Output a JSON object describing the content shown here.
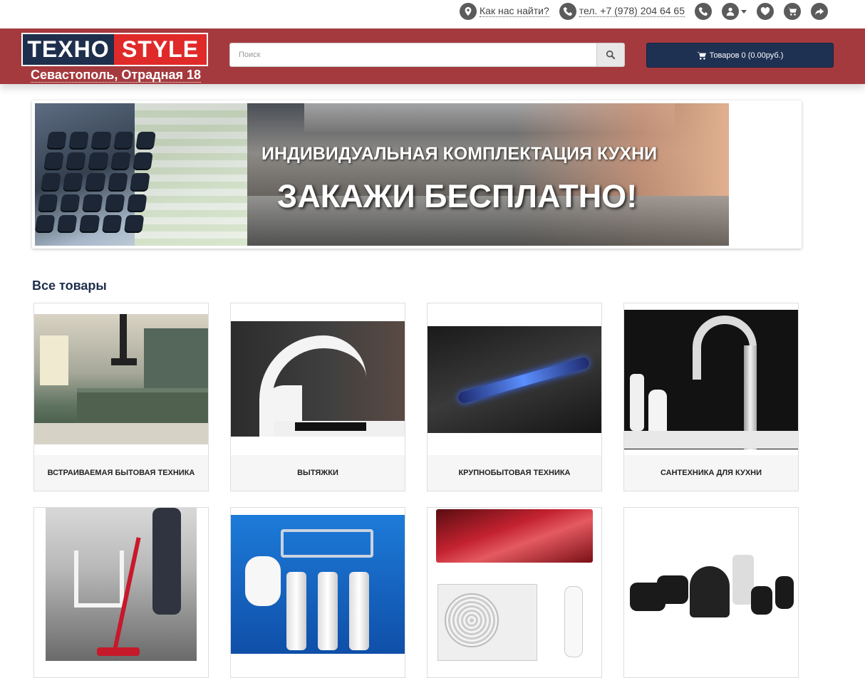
{
  "topbar": {
    "find_us": "Как нас найти?",
    "phone": "тел. +7 (978) 204 64 65",
    "icons": [
      "map-marker-icon",
      "phone-icon",
      "phone-icon",
      "user-icon",
      "heart-icon",
      "shopping-cart-icon",
      "share-icon"
    ]
  },
  "header": {
    "logo_part1": "TEXHO",
    "logo_part2": "STYLE",
    "address": "Севастополь, Отрадная 18",
    "search_placeholder": "Поиск",
    "cart_label": "Товаров 0 (0.00руб.)",
    "colors": {
      "header_bg": "#a53a3e",
      "logo_dark": "#1e2f4d",
      "logo_red": "#e02a2a",
      "cart_bg": "#1f3152"
    }
  },
  "banner": {
    "line1": "ИНДИВИДУАЛЬНАЯ КОМПЛЕКТАЦИЯ КУХНИ",
    "line2": "ЗАКАЖИ БЕСПЛАТНО!"
  },
  "section": {
    "title": "Все товары",
    "categories": [
      {
        "label": "Встраиваемая бытовая техника"
      },
      {
        "label": "Вытяжки"
      },
      {
        "label": "Крупнобытовая техника"
      },
      {
        "label": "Сантехника для кухни"
      },
      {
        "label": ""
      },
      {
        "label": ""
      },
      {
        "label": ""
      },
      {
        "label": ""
      }
    ]
  }
}
